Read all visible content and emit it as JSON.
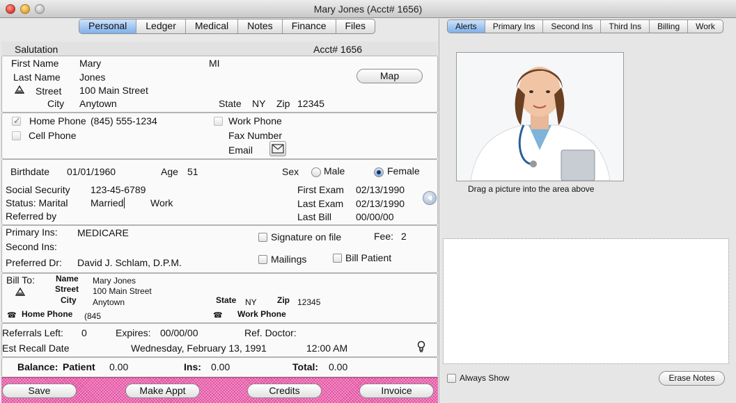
{
  "window": {
    "title": "Mary Jones (Acct# 1656)"
  },
  "tabs_left": [
    "Personal",
    "Ledger",
    "Medical",
    "Notes",
    "Finance",
    "Files"
  ],
  "tabs_right": [
    "Alerts",
    "Primary Ins",
    "Second Ins",
    "Third Ins",
    "Billing",
    "Work"
  ],
  "header": {
    "salutation_label": "Salutation",
    "acct_label": "Acct# 1656"
  },
  "name": {
    "first_label": "First Name",
    "first": "Mary",
    "mi_label": "MI",
    "last_label": "Last Name",
    "last": "Jones",
    "street_label": "Street",
    "street": "100 Main Street",
    "city_label": "City",
    "city": "Anytown",
    "state_label": "State",
    "state": "NY",
    "zip_label": "Zip",
    "zip": "12345",
    "map_button": "Map"
  },
  "phones": {
    "home_label": "Home Phone",
    "home": "(845) 555-1234",
    "cell_label": "Cell Phone",
    "work_label": "Work Phone",
    "fax_label": "Fax Number",
    "email_label": "Email"
  },
  "demographics": {
    "birthdate_label": "Birthdate",
    "birthdate": "01/01/1960",
    "age_label": "Age",
    "age": "51",
    "sex_label": "Sex",
    "male_label": "Male",
    "female_label": "Female",
    "ssn_label": "Social Security",
    "ssn": "123-45-6789",
    "status_label": "Status: Marital",
    "marital": "Married",
    "work_label": "Work",
    "referred_label": "Referred by",
    "first_exam_label": "First Exam",
    "first_exam": "02/13/1990",
    "last_exam_label": "Last Exam",
    "last_exam": "02/13/1990",
    "last_bill_label": "Last Bill",
    "last_bill": "00/00/00"
  },
  "insurance": {
    "primary_label": "Primary Ins:",
    "primary": "MEDICARE",
    "second_label": "Second Ins:",
    "dr_label": "Preferred Dr:",
    "dr": "David J. Schlam, D.P.M.",
    "signature_label": "Signature on file",
    "fee_label": "Fee:",
    "fee": "2",
    "mailings_label": "Mailings",
    "bill_patient_label": "Bill Patient"
  },
  "bill_to": {
    "label": "Bill To:",
    "name_label": "Name",
    "name": "Mary Jones",
    "street_label": "Street",
    "street": "100 Main Street",
    "city_label": "City",
    "city": "Anytown",
    "state_label": "State",
    "state": "NY",
    "zip_label": "Zip",
    "zip": "12345",
    "home_label": "Home Phone",
    "home": "(845",
    "work_label": "Work Phone"
  },
  "referrals": {
    "left_label": "Referrals Left:",
    "left": "0",
    "expires_label": "Expires:",
    "expires": "00/00/00",
    "doctor_label": "Ref. Doctor:",
    "recall_label": "Est Recall Date",
    "recall_date": "Wednesday, February 13, 1991",
    "recall_time": "12:00 AM"
  },
  "balance": {
    "label": "Balance:",
    "patient_label": "Patient",
    "patient": "0.00",
    "ins_label": "Ins:",
    "ins": "0.00",
    "total_label": "Total:",
    "total": "0.00"
  },
  "actions": {
    "save": "Save",
    "make_appt": "Make Appt",
    "credits": "Credits",
    "invoice": "Invoice"
  },
  "right": {
    "drag_hint": "Drag a picture into the area above",
    "always_show": "Always Show",
    "erase_notes": "Erase Notes"
  },
  "icons": [
    "house-icon",
    "phone-icon",
    "envelope-icon",
    "lightbulb-icon",
    "back-arrow-icon"
  ],
  "colors": {
    "action_bar": "#e4489e",
    "active_tab": "#7fb0ea"
  }
}
